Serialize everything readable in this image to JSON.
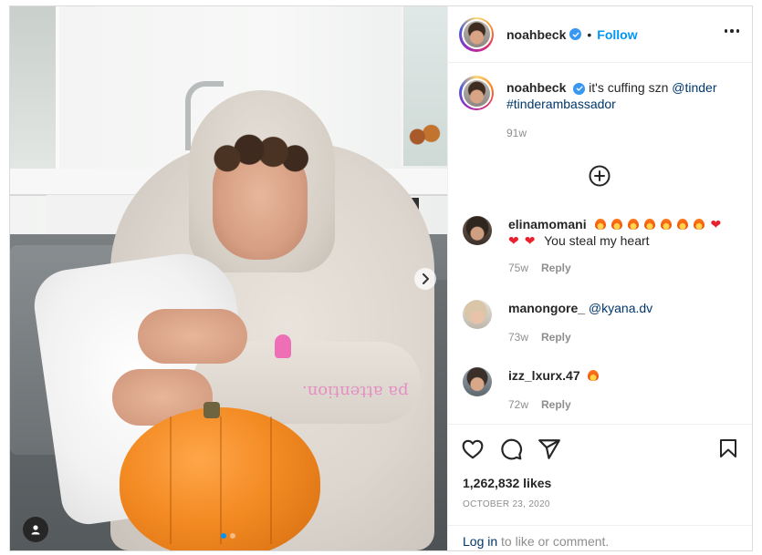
{
  "post": {
    "username": "noahbeck",
    "follow_label": "Follow",
    "separator": "•",
    "caption_text": "it's cuffing szn",
    "caption_mention": "@tinder",
    "caption_hashtag": "#tinderambassador",
    "caption_age": "91w",
    "sleeve_print": "pa attention."
  },
  "comments": [
    {
      "user": "elinamomani",
      "emoji_line1": [
        "fire",
        "fire",
        "fire",
        "fire",
        "fire",
        "fire",
        "fire",
        "heart"
      ],
      "emoji_line2": [
        "heart",
        "heart"
      ],
      "text": "You steal my heart",
      "age": "75w",
      "reply_label": "Reply"
    },
    {
      "user": "manongore_",
      "mention": "@kyana.dv",
      "age": "73w",
      "reply_label": "Reply"
    },
    {
      "user": "izz_lxurx.47",
      "emoji": [
        "fire"
      ],
      "age": "72w",
      "reply_label": "Reply"
    }
  ],
  "actions": {
    "likes": "1,262,832 likes",
    "date": "OCTOBER 23, 2020",
    "login_link": "Log in",
    "login_suffix": " to like or comment."
  },
  "carousel": {
    "current": 1,
    "total": 2
  },
  "icons": {
    "more": "more-options-icon",
    "verified": "verified-badge-icon",
    "load_more": "plus-circle-icon",
    "like": "heart-icon",
    "comment": "comment-icon",
    "share": "share-icon",
    "save": "bookmark-icon",
    "next": "chevron-right-icon",
    "tag": "user-tag-icon"
  },
  "colors": {
    "accent": "#0095f6",
    "text": "#262626",
    "muted": "#8e8e8e",
    "link": "#00376b",
    "verified": "#3897f0"
  }
}
